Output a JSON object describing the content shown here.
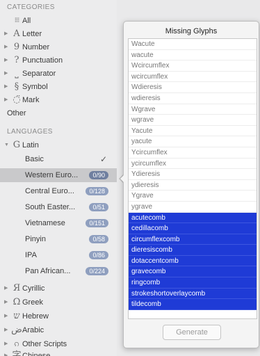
{
  "sidebar": {
    "categories_header": "CATEGORIES",
    "categories": [
      {
        "glyph": "⁝⁝⁝",
        "label": "All",
        "arrow": ""
      },
      {
        "glyph": "A",
        "label": "Letter",
        "arrow": "▶"
      },
      {
        "glyph": "9",
        "label": "Number",
        "arrow": "▶"
      },
      {
        "glyph": "?",
        "label": "Punctuation",
        "arrow": "▶"
      },
      {
        "glyph": "⎵",
        "label": "Separator",
        "arrow": "▶"
      },
      {
        "glyph": "§",
        "label": "Symbol",
        "arrow": "▶"
      },
      {
        "glyph": "◌̈",
        "label": "Mark",
        "arrow": "▶"
      },
      {
        "glyph": "",
        "label": "Other",
        "arrow": ""
      }
    ],
    "languages_header": "LANGUAGES",
    "latin": {
      "glyph": "G",
      "label": "Latin",
      "arrow": "▼"
    },
    "latin_subitems": [
      {
        "label": "Basic",
        "badge": "",
        "check": "✓"
      },
      {
        "label": "Western Euro...",
        "badge": "0/90",
        "check": ""
      },
      {
        "label": "Central Euro...",
        "badge": "0/128",
        "check": ""
      },
      {
        "label": "South Easter...",
        "badge": "0/51",
        "check": ""
      },
      {
        "label": "Vietnamese",
        "badge": "0/151",
        "check": ""
      },
      {
        "label": "Pinyin",
        "badge": "0/58",
        "check": ""
      },
      {
        "label": "IPA",
        "badge": "0/86",
        "check": ""
      },
      {
        "label": "Pan African...",
        "badge": "0/224",
        "check": ""
      }
    ],
    "scripts": [
      {
        "glyph": "Я",
        "label": "Cyrillic",
        "arrow": "▶"
      },
      {
        "glyph": "Ω",
        "label": "Greek",
        "arrow": "▶"
      },
      {
        "glyph": "ש",
        "label": "Hebrew",
        "arrow": "▶"
      },
      {
        "glyph": "ض",
        "label": "Arabic",
        "arrow": "▶"
      },
      {
        "glyph": "ၵ",
        "label": "Other Scripts",
        "arrow": "▶"
      },
      {
        "glyph": "字",
        "label": "Chinese",
        "arrow": "▶"
      }
    ]
  },
  "popover": {
    "title": "Missing Glyphs",
    "glyphs": [
      "Wacute",
      "wacute",
      "Wcircumflex",
      "wcircumflex",
      "Wdieresis",
      "wdieresis",
      "Wgrave",
      "wgrave",
      "Yacute",
      "yacute",
      "Ycircumflex",
      "ycircumflex",
      "Ydieresis",
      "ydieresis",
      "Ygrave",
      "ygrave",
      "acutecomb",
      "cedillacomb",
      "circumflexcomb",
      "dieresiscomb",
      "dotaccentcomb",
      "gravecomb",
      "ringcomb",
      "strokeshortoverlaycomb",
      "tildecomb"
    ],
    "selected_from": "acutecomb",
    "generate_label": "Generate"
  },
  "colors": {
    "selection": "#1f3bd6",
    "badge": "#8f9fbf",
    "sidebar_bg": "#ececed",
    "sidebar_selected": "#c9c9cb"
  }
}
